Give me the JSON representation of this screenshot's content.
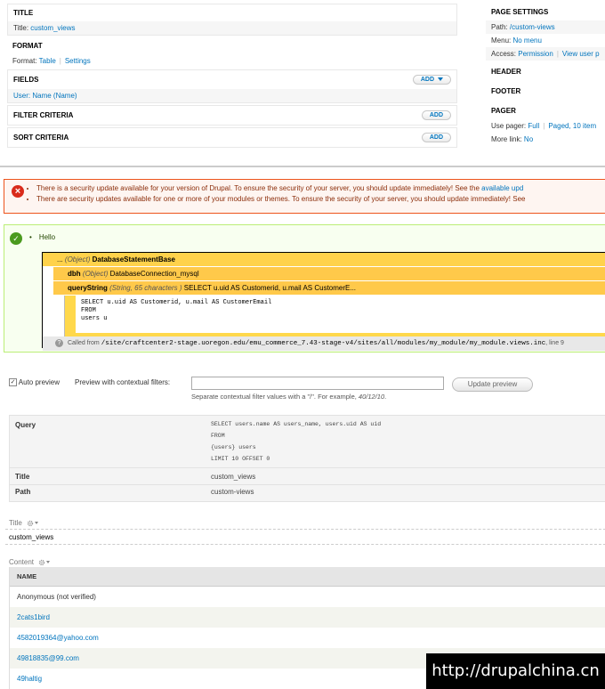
{
  "left": {
    "title": {
      "heading": "TITLE",
      "label": "Title:",
      "value": "custom_views"
    },
    "format": {
      "heading": "FORMAT",
      "label": "Format:",
      "value": "Table",
      "settings": "Settings"
    },
    "fields": {
      "heading": "FIELDS",
      "add": "Add",
      "item": "User: Name (Name)"
    },
    "filter": {
      "heading": "FILTER CRITERIA",
      "add": "Add"
    },
    "sort": {
      "heading": "SORT CRITERIA",
      "add": "Add"
    }
  },
  "right": {
    "page_settings": {
      "heading": "PAGE SETTINGS"
    },
    "path": {
      "label": "Path:",
      "value": "/custom-views"
    },
    "menu": {
      "label": "Menu:",
      "value": "No menu"
    },
    "access": {
      "label": "Access:",
      "value": "Permission",
      "extra": "View user p"
    },
    "header": "HEADER",
    "footer": "FOOTER",
    "pager": {
      "heading": "PAGER",
      "label": "Use pager:",
      "value": "Full",
      "extra": "Paged, 10 item"
    },
    "more": {
      "label": "More link:",
      "value": "No"
    }
  },
  "error": {
    "line1_text": "There is a security update available for your version of Drupal. To ensure the security of your server, you should update immediately! See the ",
    "line1_link": "available upd",
    "line2_text": "There are security updates available for one or more of your modules or themes. To ensure the security of your server, you should update immediately! See"
  },
  "status": {
    "message": "Hello",
    "krumo": {
      "row1_prefix": "...",
      "row1_type": "(Object)",
      "row1_value": "DatabaseStatementBase",
      "row2_key": "dbh",
      "row2_type": "(Object)",
      "row2_value": "DatabaseConnection_mysql",
      "row3_key": "queryString",
      "row3_type": "(String, 65 characters )",
      "row3_value": "SELECT u.uid AS Customerid, u.mail AS CustomerE...",
      "code": "SELECT u.uid AS Customerid, u.mail AS CustomerEmail\nFROM\nusers u",
      "called_from": "Called from",
      "called_path": "/site/craftcenter2-stage.uoregon.edu/emu_commerce_7.43-stage-v4/sites/all/modules/my_module/my_module.views.inc",
      "called_line": ", line 9"
    }
  },
  "preview": {
    "auto_preview": "Auto preview",
    "ctx_label": "Preview with contextual filters:",
    "ctx_desc_prefix": "Separate contextual filter values with a \"/\". For example, ",
    "ctx_desc_example": "40/12/10",
    "ctx_desc_suffix": ".",
    "update_button": "Update preview"
  },
  "query_info": {
    "query_label": "Query",
    "query_sql": "SELECT users.name AS users_name, users.uid AS uid\nFROM\n{users} users\nLIMIT 10 OFFSET 0",
    "title_label": "Title",
    "title_value": "custom_views",
    "path_label": "Path",
    "path_value": "custom-views"
  },
  "output": {
    "title_area": "Title",
    "title_value": "custom_views",
    "content_area": "Content",
    "column_header": "NAME",
    "rows": [
      "Anonymous (not verified)",
      "2cats1bird",
      "4582019364@yahoo.com",
      "49818835@99.com",
      "49haltig"
    ]
  },
  "watermark": "http://drupalchina.cn"
}
